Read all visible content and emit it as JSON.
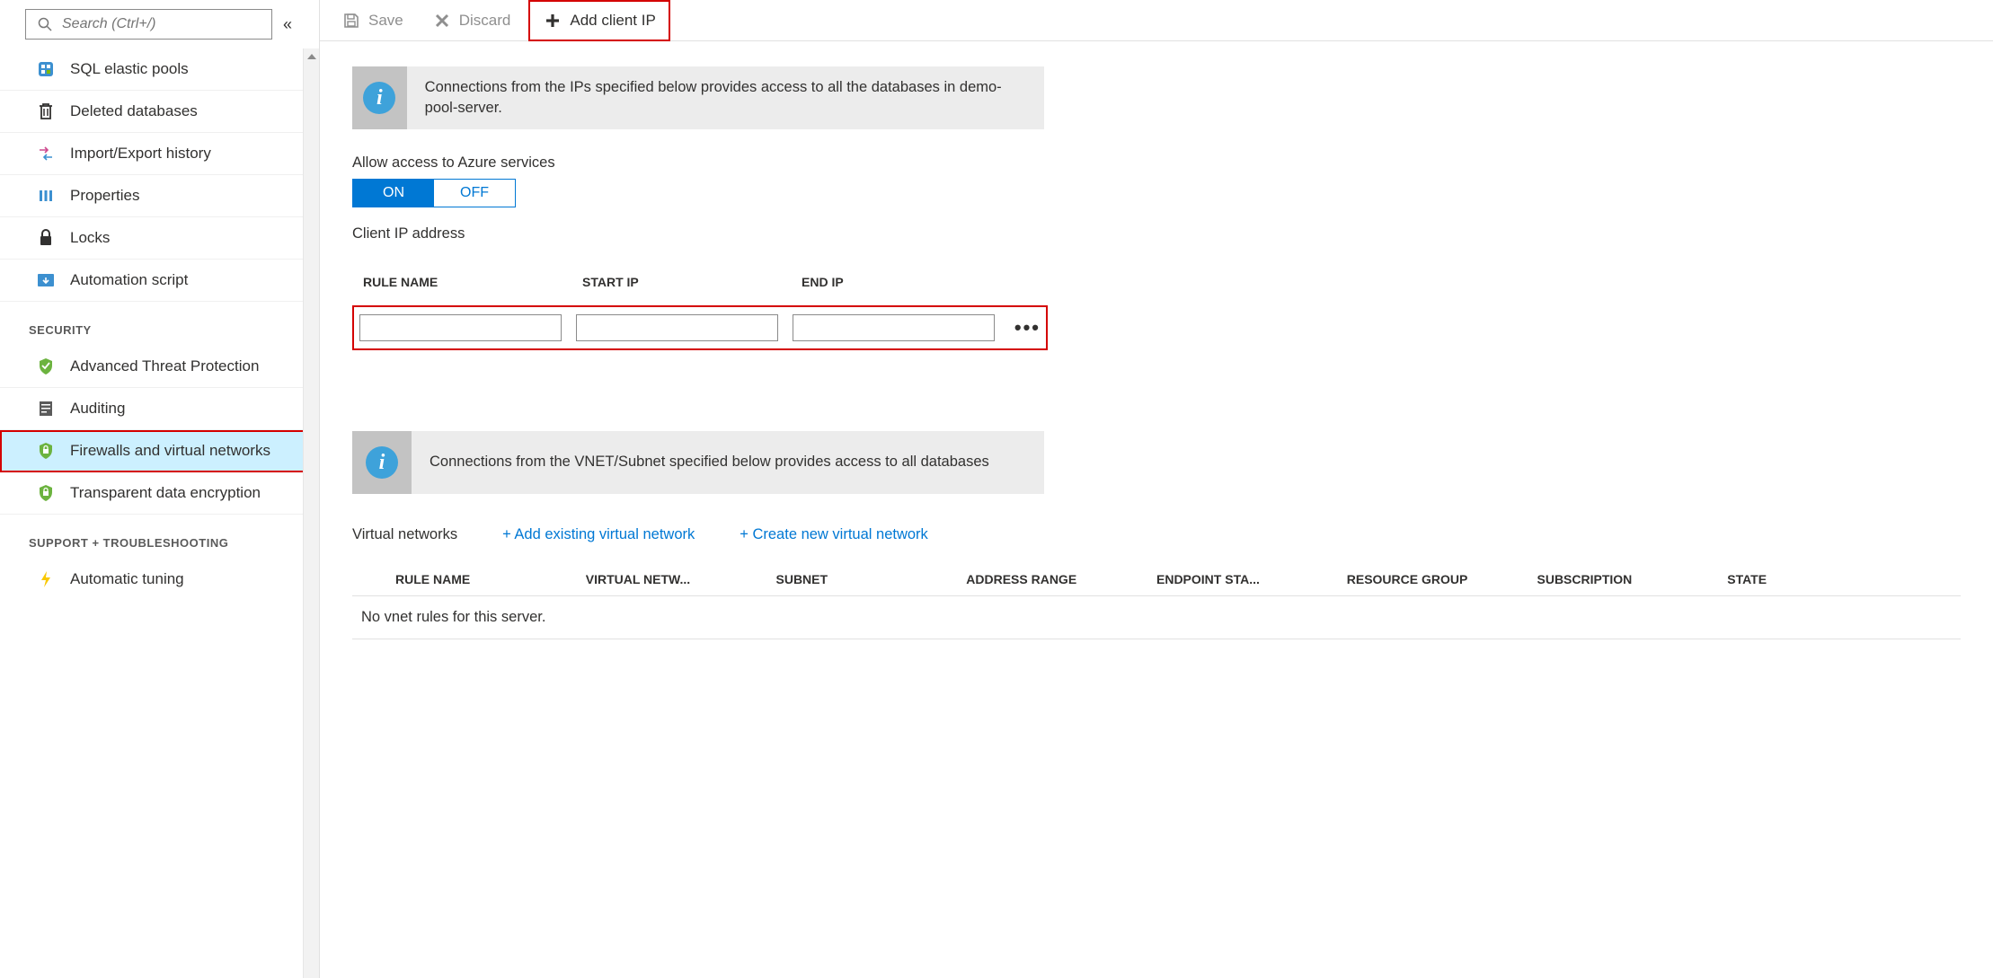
{
  "sidebar": {
    "search_placeholder": "Search (Ctrl+/)",
    "items": {
      "elastic_pools": "SQL elastic pools",
      "deleted_dbs": "Deleted databases",
      "import_export": "Import/Export history",
      "properties": "Properties",
      "locks": "Locks",
      "automation": "Automation script"
    },
    "security_header": "SECURITY",
    "security_items": {
      "atp": "Advanced Threat Protection",
      "auditing": "Auditing",
      "firewalls": "Firewalls and virtual networks",
      "tde": "Transparent data encryption"
    },
    "support_header": "SUPPORT + TROUBLESHOOTING",
    "support_items": {
      "auto_tuning": "Automatic tuning"
    }
  },
  "toolbar": {
    "save": "Save",
    "discard": "Discard",
    "add_client_ip": "Add client IP"
  },
  "main": {
    "info1": "Connections from the IPs specified below provides access to all the databases in demo-pool-server.",
    "allow_azure_label": "Allow access to Azure services",
    "toggle_on": "ON",
    "toggle_off": "OFF",
    "client_ip_label": "Client IP address",
    "fw_headers": {
      "rule": "RULE NAME",
      "start": "START IP",
      "end": "END IP"
    },
    "fw_row": {
      "rule": "",
      "start": "",
      "end": ""
    },
    "info2": "Connections from the VNET/Subnet specified below provides access to all databases",
    "vnet_label": "Virtual networks",
    "add_existing": "+ Add existing virtual network",
    "create_new": "+ Create new virtual network",
    "vnet_headers": {
      "rule": "RULE NAME",
      "vnet": "VIRTUAL NETW...",
      "subnet": "SUBNET",
      "range": "ADDRESS RANGE",
      "endpoint": "ENDPOINT STA...",
      "rg": "RESOURCE GROUP",
      "sub": "SUBSCRIPTION",
      "state": "STATE"
    },
    "vnet_empty": "No vnet rules for this server."
  }
}
